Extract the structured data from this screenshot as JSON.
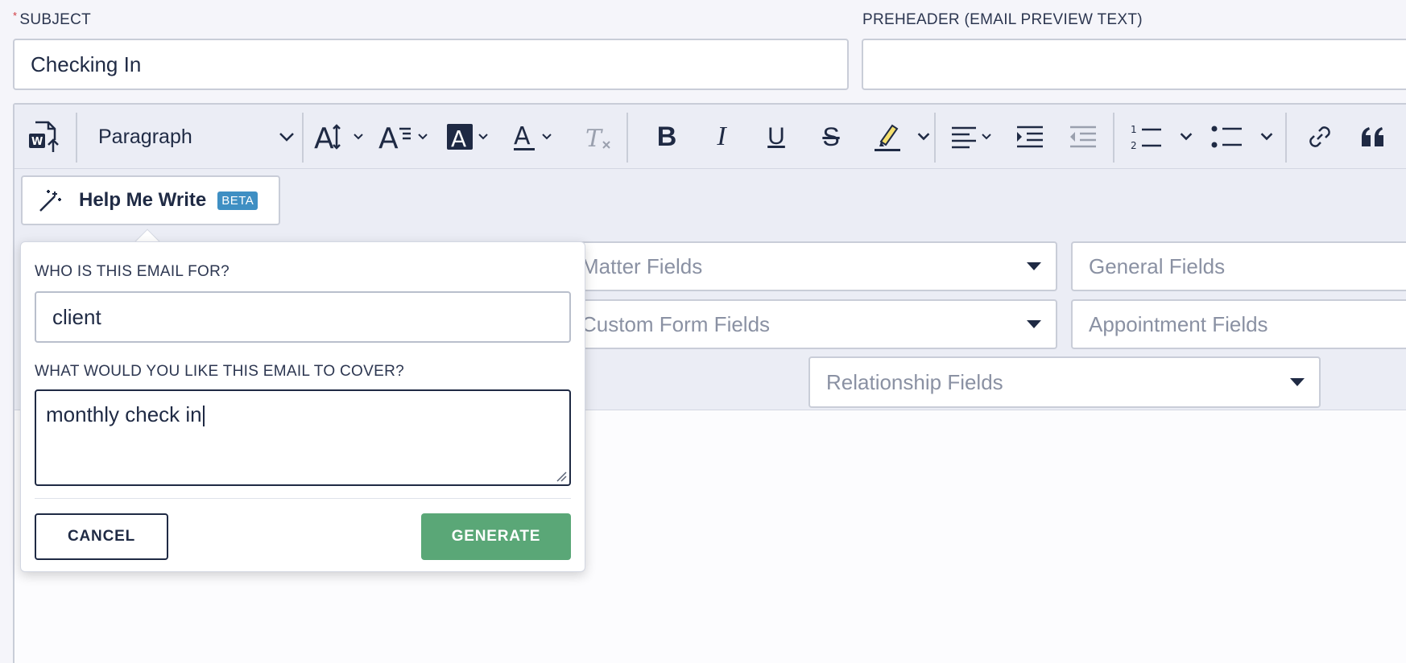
{
  "subject": {
    "label": "SUBJECT",
    "value": "Checking In"
  },
  "preheader": {
    "label": "PREHEADER (EMAIL PREVIEW TEXT)",
    "value": ""
  },
  "toolbar": {
    "paragraph_select": "Paragraph",
    "icons": [
      "import-word-icon",
      "font-size-icon",
      "line-height-icon",
      "font-background-color-icon",
      "font-color-icon",
      "remove-format-icon",
      "bold-icon",
      "italic-icon",
      "underline-icon",
      "strikethrough-icon",
      "highlight-icon",
      "align-left-icon",
      "outdent-icon",
      "indent-icon",
      "numbered-list-icon",
      "bulleted-list-icon",
      "link-icon",
      "blockquote-icon"
    ]
  },
  "help_me_write": {
    "label": "Help Me Write",
    "badge": "BETA"
  },
  "merge_fields": {
    "matter": "Matter Fields",
    "general": "General Fields",
    "custom_form": "Custom Form Fields",
    "appointment": "Appointment Fields",
    "relationship": "Relationship Fields"
  },
  "popover": {
    "who_label": "WHO IS THIS EMAIL FOR?",
    "who_value": "client",
    "cover_label": "WHAT WOULD YOU LIKE THIS EMAIL TO COVER?",
    "cover_value": "monthly check in",
    "cancel": "CANCEL",
    "generate": "GENERATE"
  },
  "colors": {
    "generate_green": "#5aa777",
    "beta_blue": "#3f8fc3",
    "required_red": "#d0393e"
  }
}
